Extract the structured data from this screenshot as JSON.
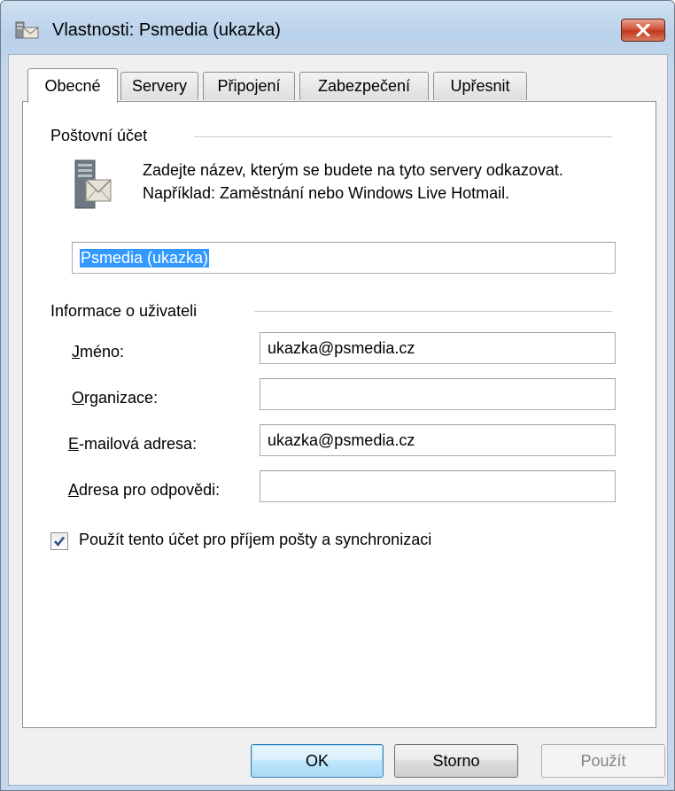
{
  "window": {
    "title": "Vlastnosti: Psmedia (ukazka)",
    "close_icon": "close-x-icon",
    "app_icon": "mail-account-icon"
  },
  "tabs": [
    {
      "label": "Obecné",
      "active": true
    },
    {
      "label": "Servery",
      "active": false
    },
    {
      "label": "Připojení",
      "active": false
    },
    {
      "label": "Zabezpečení",
      "active": false
    },
    {
      "label": "Upřesnit",
      "active": false
    }
  ],
  "mail_account": {
    "group_title": "Poštovní účet",
    "icon": "server-mail-icon",
    "description": "Zadejte název, kterým se budete na tyto servery odkazovat. Například: Zaměstnání nebo Windows Live Hotmail.",
    "account_name_value": "Psmedia (ukazka)"
  },
  "user_info": {
    "group_title": "Informace o uživateli",
    "fields": [
      {
        "label": "Jméno:",
        "value": "ukazka@psmedia.cz"
      },
      {
        "label": "Organizace:",
        "value": ""
      },
      {
        "label": "E-mailová adresa:",
        "value": "ukazka@psmedia.cz"
      },
      {
        "label": "Adresa pro odpovědi:",
        "value": ""
      }
    ]
  },
  "sync_checkbox": {
    "label": "Použít tento účet pro příjem pošty a synchronizaci",
    "checked": true
  },
  "buttons": {
    "ok": "OK",
    "cancel": "Storno",
    "apply": "Použít",
    "apply_enabled": false
  },
  "colors": {
    "selection": "#3399ff",
    "close_button": "#c2391e",
    "default_button_border": "#3c7fb1"
  }
}
